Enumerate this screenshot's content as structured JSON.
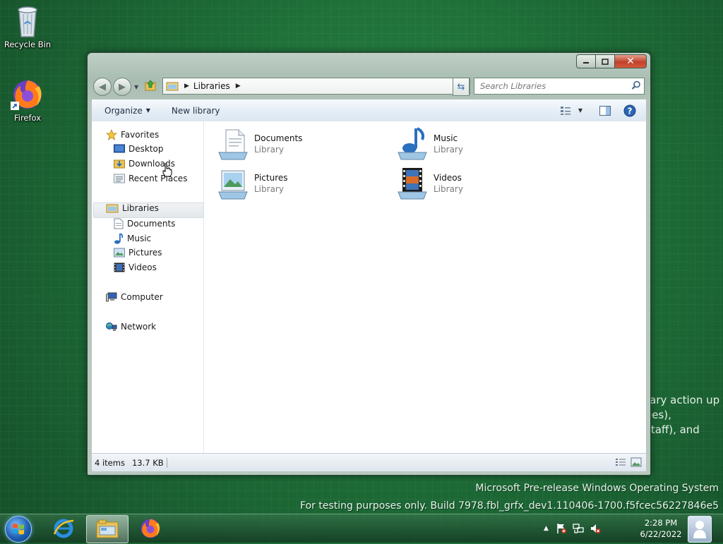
{
  "desktop": {
    "icons": [
      {
        "label": "Recycle Bin",
        "icon": "recycle-bin-icon"
      },
      {
        "label": "Firefox",
        "icon": "firefox-icon"
      }
    ],
    "background_text_lines": [
      "rary action up",
      "ees),",
      "staff), and"
    ],
    "watermark_line1": "Microsoft Pre-release Windows Operating System",
    "watermark_line2": "For testing purposes only. Build 7978.fbl_grfx_dev1.110406-1700.f5fcec56227846e5"
  },
  "explorer": {
    "address": {
      "path": "Libraries"
    },
    "search": {
      "placeholder": "Search Libraries"
    },
    "toolbar": {
      "organize_label": "Organize",
      "new_library_label": "New library"
    },
    "nav": {
      "favorites": "Favorites",
      "favorite_items": [
        "Desktop",
        "Downloads",
        "Recent Places"
      ],
      "libraries": "Libraries",
      "library_items": [
        "Documents",
        "Music",
        "Pictures",
        "Videos"
      ],
      "computer": "Computer",
      "network": "Network"
    },
    "items": [
      {
        "name": "Documents",
        "type": "Library",
        "icon": "documents-library-icon"
      },
      {
        "name": "Music",
        "type": "Library",
        "icon": "music-library-icon"
      },
      {
        "name": "Pictures",
        "type": "Library",
        "icon": "pictures-library-icon"
      },
      {
        "name": "Videos",
        "type": "Library",
        "icon": "videos-library-icon"
      }
    ],
    "status": {
      "count": "4 items",
      "size": "13.7 KB"
    }
  },
  "taskbar": {
    "clock_time": "2:28 PM",
    "clock_date": "6/22/2022",
    "apps": [
      "internet-explorer-icon",
      "windows-explorer-icon",
      "firefox-icon"
    ]
  },
  "colors": {
    "accent": "#1d5fb0",
    "desktop": "#1c6a33",
    "close_button": "#c0412a"
  }
}
